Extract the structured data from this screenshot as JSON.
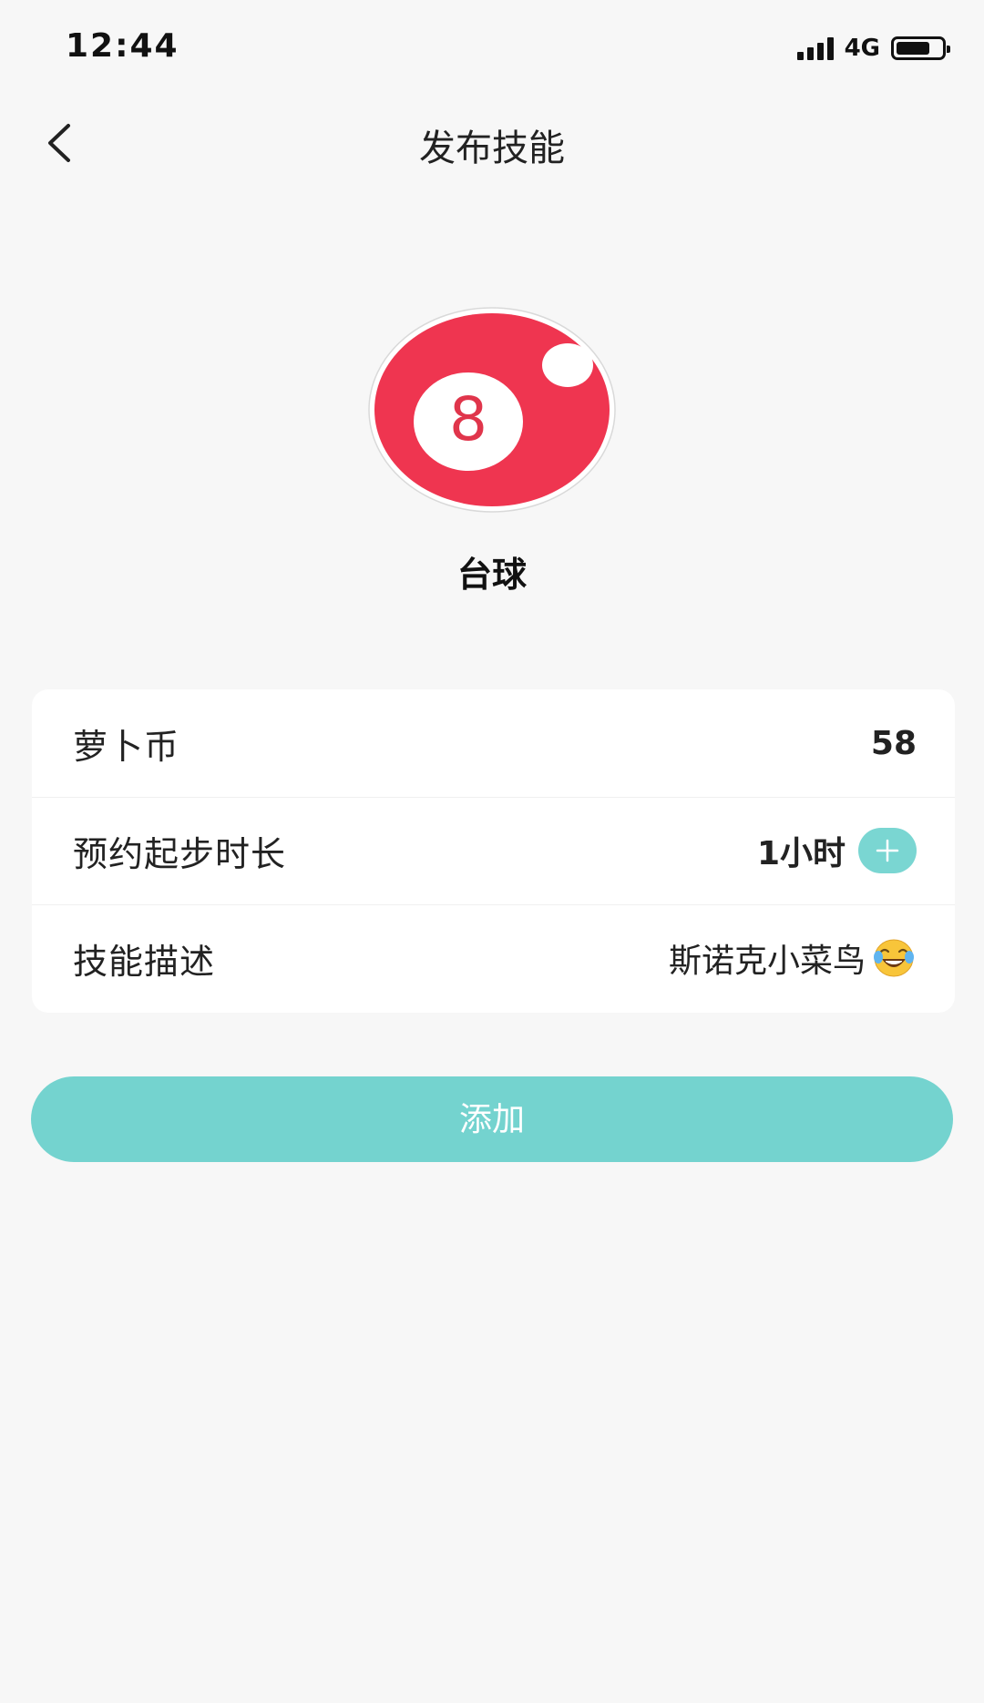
{
  "status_bar": {
    "time": "12:44",
    "network": "4G",
    "battery_level_pct": 75
  },
  "nav": {
    "title": "发布技能"
  },
  "skill": {
    "name": "台球",
    "icon_number": "8",
    "icon_color": "#ef3550"
  },
  "form": {
    "rows": [
      {
        "label": "萝卜币",
        "value": "58"
      },
      {
        "label": "预约起步时长",
        "value": "1小时"
      },
      {
        "label": "技能描述",
        "value": "斯诺克小菜鸟"
      }
    ]
  },
  "actions": {
    "add_label": "添加"
  },
  "colors": {
    "accent": "#74d3cf",
    "background": "#f7f7f7",
    "card": "#ffffff"
  },
  "icons": {
    "back": "chevron-left-icon",
    "plus": "plus-icon",
    "emoji": "tears-of-joy-emoji-icon",
    "skill": "billiard-ball-icon"
  }
}
